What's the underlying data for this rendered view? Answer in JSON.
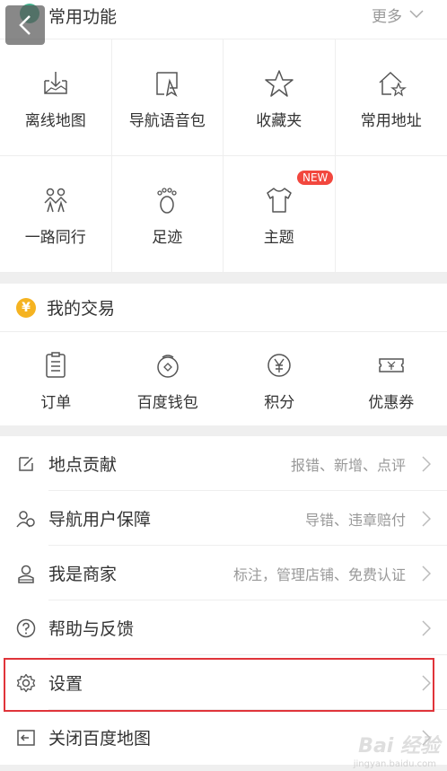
{
  "common": {
    "title": "常用功能",
    "more_label": "更多",
    "items": [
      {
        "label": "离线地图",
        "icon": "download-map-icon"
      },
      {
        "label": "导航语音包",
        "icon": "voice-pack-icon"
      },
      {
        "label": "收藏夹",
        "icon": "star-icon"
      },
      {
        "label": "常用地址",
        "icon": "home-star-icon"
      },
      {
        "label": "一路同行",
        "icon": "people-icon"
      },
      {
        "label": "足迹",
        "icon": "footprint-icon"
      },
      {
        "label": "主题",
        "icon": "tshirt-icon",
        "badge": "NEW"
      },
      {
        "label": "",
        "icon": ""
      }
    ]
  },
  "trade": {
    "icon_glyph": "¥",
    "title": "我的交易",
    "items": [
      {
        "label": "订单",
        "icon": "clipboard-icon"
      },
      {
        "label": "百度钱包",
        "icon": "wallet-icon"
      },
      {
        "label": "积分",
        "icon": "points-yen-icon"
      },
      {
        "label": "优惠券",
        "icon": "coupon-icon"
      }
    ]
  },
  "list": [
    {
      "label": "地点贡献",
      "sub": "报错、新增、点评",
      "icon": "edit-icon"
    },
    {
      "label": "导航用户保障",
      "sub": "导错、违章赔付",
      "icon": "users-shield-icon"
    },
    {
      "label": "我是商家",
      "sub": "标注，管理店铺、免费认证",
      "icon": "merchant-icon"
    },
    {
      "label": "帮助与反馈",
      "sub": "",
      "icon": "help-icon"
    },
    {
      "label": "设置",
      "sub": "",
      "icon": "gear-icon"
    },
    {
      "label": "关闭百度地图",
      "sub": "",
      "icon": "exit-icon"
    }
  ],
  "watermark": {
    "main": "Bai 经验",
    "sub": "jingyan.baidu.com"
  },
  "colors": {
    "accent_red": "#e0343a",
    "badge_red": "#f2473e",
    "yen_orange": "#f5b321",
    "text": "#333333",
    "muted": "#999999"
  }
}
